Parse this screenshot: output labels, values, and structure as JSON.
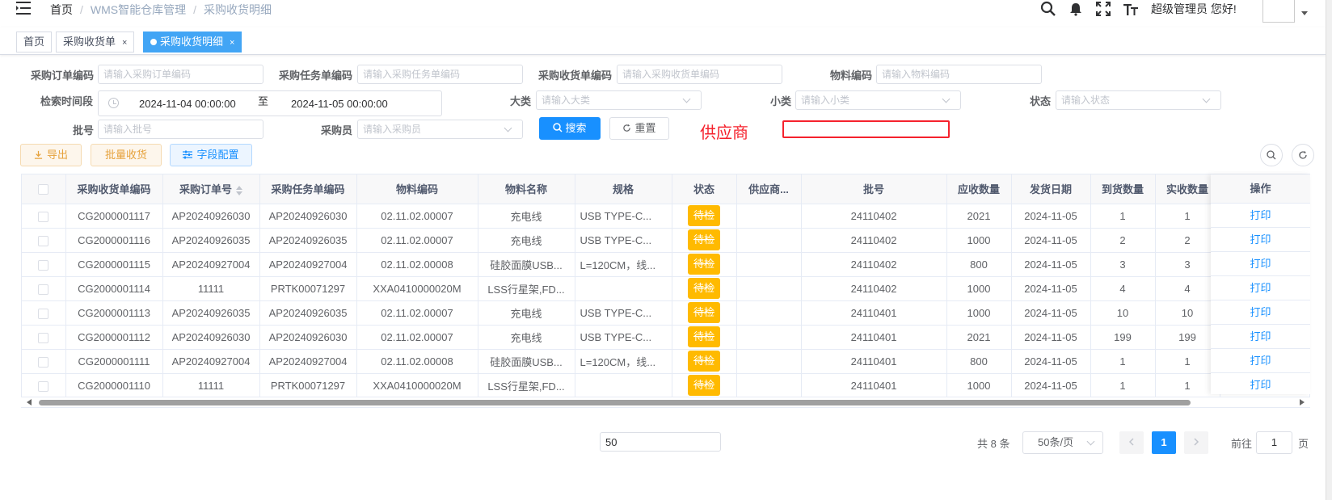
{
  "breadcrumb": [
    "首页",
    "WMS智能仓库管理",
    "采购收货明细"
  ],
  "header": {
    "greeting": "超级管理员 您好!"
  },
  "tags": [
    {
      "label": "首页",
      "active": false,
      "closable": false
    },
    {
      "label": "采购收货单",
      "active": false,
      "closable": true
    },
    {
      "label": "采购收货明细",
      "active": true,
      "closable": true
    }
  ],
  "filters": {
    "order_code": {
      "label": "采购订单编码",
      "placeholder": "请输入采购订单编码"
    },
    "task_code": {
      "label": "采购任务单编码",
      "placeholder": "请输入采购任务单编码"
    },
    "receipt_code": {
      "label": "采购收货单编码",
      "placeholder": "请输入采购收货单编码"
    },
    "material_code": {
      "label": "物料编码",
      "placeholder": "请输入物料编码"
    },
    "time_range": {
      "label": "检索时间段",
      "start": "2024-11-04 00:00:00",
      "separator": "至",
      "end": "2024-11-05 00:00:00"
    },
    "category": {
      "label": "大类",
      "placeholder": "请输入大类"
    },
    "subcategory": {
      "label": "小类",
      "placeholder": "请输入小类"
    },
    "status": {
      "label": "状态",
      "placeholder": "请输入状态"
    },
    "batch": {
      "label": "批号",
      "placeholder": "请输入批号"
    },
    "buyer": {
      "label": "采购员",
      "placeholder": "请输入采购员"
    },
    "search_btn": "搜索",
    "reset_btn": "重置",
    "supplier_label": "供应商"
  },
  "toolbar": {
    "export": "导出",
    "batch_receive": "批量收货",
    "field_config": "字段配置"
  },
  "table": {
    "columns": [
      "采购收货单编码",
      "采购订单号",
      "采购任务单编码",
      "物料编码",
      "物料名称",
      "规格",
      "状态",
      "供应商...",
      "批号",
      "应收数量",
      "发货日期",
      "到货数量",
      "实收数量",
      "操作"
    ],
    "rows": [
      [
        "CG2000001117",
        "AP20240926030",
        "AP20240926030",
        "02.11.02.00007",
        "充电线",
        "USB TYPE-C...",
        "待检",
        "",
        "24110402",
        "2021",
        "2024-11-05",
        "1",
        "1",
        "打印"
      ],
      [
        "CG2000001116",
        "AP20240926035",
        "AP20240926035",
        "02.11.02.00007",
        "充电线",
        "USB TYPE-C...",
        "待检",
        "",
        "24110402",
        "1000",
        "2024-11-05",
        "2",
        "2",
        "打印"
      ],
      [
        "CG2000001115",
        "AP20240927004",
        "AP20240927004",
        "02.11.02.00008",
        "硅胶面膜USB...",
        "L=120CM，线...",
        "待检",
        "",
        "24110402",
        "800",
        "2024-11-05",
        "3",
        "3",
        "打印"
      ],
      [
        "CG2000001114",
        "11111",
        "PRTK00071297",
        "XXA0410000020M",
        "LSS行星架,FD...",
        "",
        "待检",
        "",
        "24110402",
        "1000",
        "2024-11-05",
        "4",
        "4",
        "打印"
      ],
      [
        "CG2000001113",
        "AP20240926035",
        "AP20240926035",
        "02.11.02.00007",
        "充电线",
        "USB TYPE-C...",
        "待检",
        "",
        "24110401",
        "1000",
        "2024-11-05",
        "10",
        "10",
        "打印"
      ],
      [
        "CG2000001112",
        "AP20240926030",
        "AP20240926030",
        "02.11.02.00007",
        "充电线",
        "USB TYPE-C...",
        "待检",
        "",
        "24110401",
        "2021",
        "2024-11-05",
        "199",
        "199",
        "打印"
      ],
      [
        "CG2000001111",
        "AP20240927004",
        "AP20240927004",
        "02.11.02.00008",
        "硅胶面膜USB...",
        "L=120CM，线...",
        "待检",
        "",
        "24110401",
        "800",
        "2024-11-05",
        "1",
        "1",
        "打印"
      ],
      [
        "CG2000001110",
        "11111",
        "PRTK00071297",
        "XXA0410000020M",
        "LSS行星架,FD...",
        "",
        "待检",
        "",
        "24110401",
        "1000",
        "2024-11-05",
        "1",
        "1",
        "打印"
      ]
    ]
  },
  "pagination": {
    "size_input_value": "50",
    "total": "共 8 条",
    "page_size": "50条/页",
    "current_page": "1",
    "goto_label": "前往",
    "goto_value": "1",
    "page_suffix": "页"
  }
}
